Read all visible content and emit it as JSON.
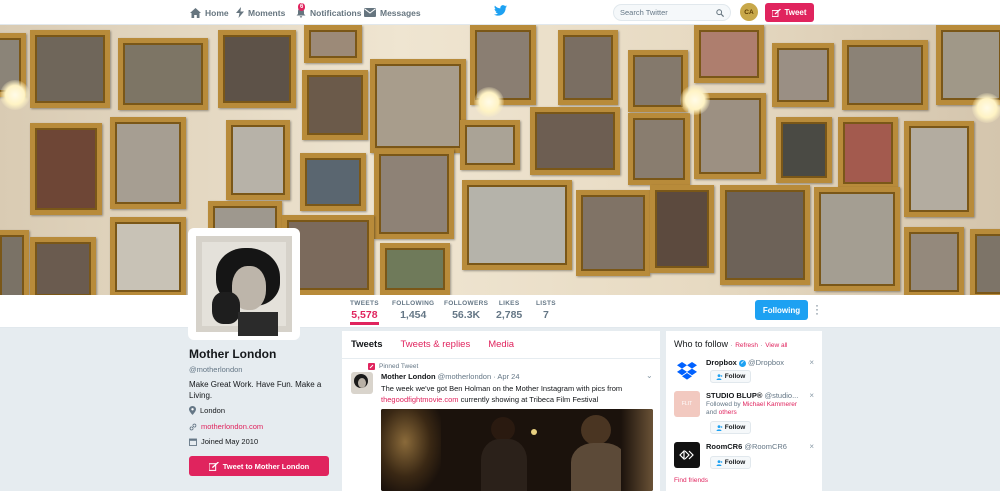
{
  "nav": {
    "home": "Home",
    "moments": "Moments",
    "notifications": "Notifications",
    "notifications_count": "6",
    "messages": "Messages",
    "search_placeholder": "Search Twitter",
    "avatar_initials": "CA",
    "tweet_button": "Tweet"
  },
  "profile_nav": {
    "stats": [
      {
        "label": "TWEETS",
        "value": "5,578"
      },
      {
        "label": "FOLLOWING",
        "value": "1,454"
      },
      {
        "label": "FOLLOWERS",
        "value": "56.3K"
      },
      {
        "label": "LIKES",
        "value": "2,785"
      },
      {
        "label": "LISTS",
        "value": "7"
      }
    ],
    "following_button": "Following"
  },
  "profile": {
    "name": "Mother London",
    "handle": "@motherlondon",
    "bio": "Make Great Work. Have Fun. Make a Living.",
    "location": "London",
    "website": "motherlondon.com",
    "joined": "Joined May 2010",
    "tweet_to_button": "Tweet to Mother London"
  },
  "timeline": {
    "tabs": [
      "Tweets",
      "Tweets & replies",
      "Media"
    ],
    "pinned_label": "Pinned Tweet",
    "tweet": {
      "name": "Mother London",
      "handle": "@motherlondon",
      "date": "· Apr 24",
      "text_before": "The week we've got Ben Holman on the Mother Instagram with pics from",
      "link": "thegoodfightmovie.com",
      "text_after": " currently showing at Tribeca Film Festival"
    }
  },
  "who_to_follow": {
    "title": "Who to follow",
    "refresh": "Refresh",
    "sep": "·",
    "view_all": "View all",
    "follow_label": "Follow",
    "suggestions": [
      {
        "name": "Dropbox",
        "handle": "@Dropbox",
        "context": ""
      },
      {
        "name": "STUDIO BLUP®",
        "handle": "@studio...",
        "context_prefix": "Followed by",
        "context_link1": "Michael Kammerer",
        "context_mid": "and",
        "context_link2": "others"
      },
      {
        "name": "RoomCR6",
        "handle": "@RoomCR6",
        "context": ""
      }
    ],
    "studio_logo_text": "FLIT",
    "find_friends": "Find friends"
  },
  "colors": {
    "accent": "#e0245e",
    "twitter_blue": "#1da1f2",
    "background": "#e6ecf0"
  }
}
